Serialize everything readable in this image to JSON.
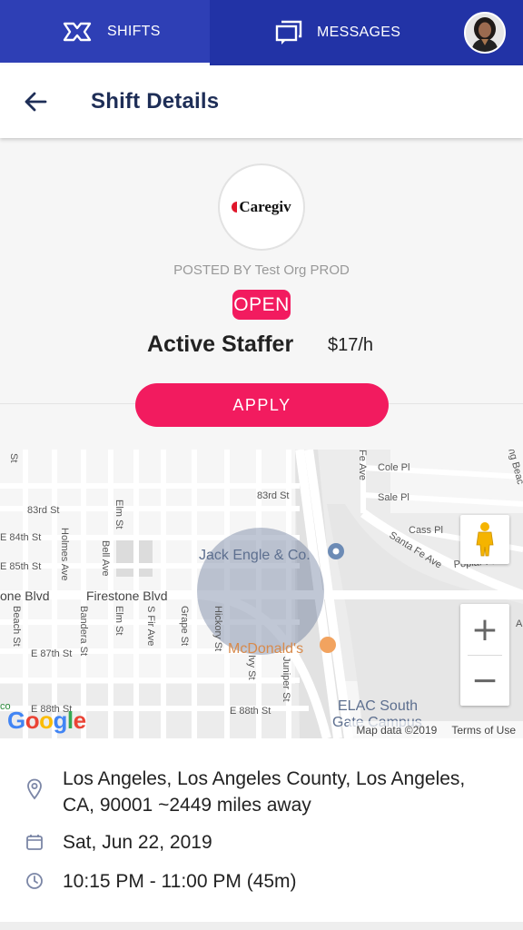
{
  "nav": {
    "shifts_label": "SHIFTS",
    "messages_label": "MESSAGES",
    "accent_color": "#2233a6"
  },
  "header": {
    "title": "Shift Details"
  },
  "shift": {
    "logo_text": "Caregiv",
    "posted_by": "POSTED BY Test Org PROD",
    "status": "OPEN",
    "role": "Active Staffer",
    "rate": "$17/h",
    "apply_label": "APPLY",
    "brand_color": "#f21b5f"
  },
  "map": {
    "streets": {
      "s83rd_left": "83rd St",
      "s83rd_right": "83rd St",
      "e84th": "E 84th St",
      "e85th": "E 85th St",
      "firestone_left": "one Blvd",
      "firestone": "Firestone Blvd",
      "e87th": "E 87th St",
      "e88th_left": "E 88th St",
      "e88th_right": "E 88th St",
      "holmes": "Holmes Ave",
      "bell": "Bell Ave",
      "elm_top": "Elm St",
      "elm_bottom": "Elm St",
      "beach": "Beach St",
      "bandera": "Bandera St",
      "s_fir": "S Fir Ave",
      "grape": "Grape St",
      "hickory": "Hickory St",
      "ivy": "Ivy St",
      "juniper": "Juniper St",
      "st_top": "St",
      "cole": "Cole Pl",
      "sale": "Sale Pl",
      "cass": "Cass Pl",
      "santa_fe": "Santa Fe Ave",
      "poplar": "Poplar Pl",
      "fe_ave": "Fe Ave",
      "ng_beac": "ng Beac",
      "a_edge": "A",
      "co_edge": "co"
    },
    "places": {
      "jack_engle": "Jack Engle & Co.",
      "mcdonalds": "McDonald's",
      "elac_line1": "ELAC South",
      "elac_line2": "Gate Campus"
    },
    "google_logo": "Google",
    "map_data": "Map data ©2019",
    "terms": "Terms of Use",
    "zoom_in": "+",
    "zoom_out": "−"
  },
  "details": {
    "location_line1": "Los Angeles, Los Angeles County, Los Angeles,",
    "location_line2": "CA, 90001 ~2449 miles away",
    "date": "Sat, Jun 22, 2019",
    "time": "10:15 PM - 11:00 PM (45m)"
  }
}
